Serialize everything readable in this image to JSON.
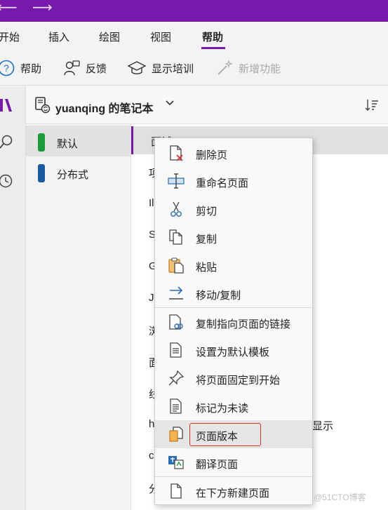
{
  "tabs": [
    {
      "label": "开始"
    },
    {
      "label": "插入"
    },
    {
      "label": "绘图"
    },
    {
      "label": "视图"
    },
    {
      "label": "帮助",
      "active": true
    }
  ],
  "ribbon": {
    "help": "帮助",
    "feedback": "反馈",
    "training": "显示培训",
    "new_features": "新增功能"
  },
  "notebook": {
    "title": "yuanqing 的笔记本"
  },
  "sections": [
    {
      "label": "默认",
      "color": "#1f9a3a",
      "selected": true
    },
    {
      "label": "分布式",
      "color": "#1a5a9e"
    }
  ],
  "pages": [
    {
      "label": "面试"
    },
    {
      "label": "项"
    },
    {
      "label": "Il"
    },
    {
      "label": "S"
    },
    {
      "label": "G"
    },
    {
      "label": "J"
    },
    {
      "label": "浏"
    },
    {
      "label": "面"
    },
    {
      "label": "线"
    },
    {
      "label": "h",
      "trailing": "显示"
    },
    {
      "label": "c"
    },
    {
      "label": "分"
    }
  ],
  "context_menu": {
    "items": [
      {
        "label": "删除页",
        "icon": "delete-page-icon"
      },
      {
        "label": "重命名页面",
        "icon": "rename-icon"
      },
      {
        "label": "剪切",
        "icon": "scissors-icon"
      },
      {
        "label": "复制",
        "icon": "copy-icon"
      },
      {
        "label": "粘贴",
        "icon": "paste-icon"
      },
      {
        "label": "移动/复制",
        "icon": "move-copy-icon"
      },
      {
        "label": "复制指向页面的链接",
        "icon": "link-page-icon"
      },
      {
        "label": "设置为默认模板",
        "icon": "template-icon"
      },
      {
        "label": "将页面固定到开始",
        "icon": "pin-icon"
      },
      {
        "label": "标记为未读",
        "icon": "unread-icon"
      },
      {
        "label": "页面版本",
        "icon": "page-versions-icon",
        "highlighted": true
      },
      {
        "label": "翻译页面",
        "icon": "translate-icon"
      },
      {
        "label": "在下方新建页面",
        "icon": "new-page-below-icon"
      }
    ]
  },
  "watermark": "@51CTO博客",
  "colors": {
    "accent": "#7719aa",
    "highlight_border": "#e0302a"
  }
}
